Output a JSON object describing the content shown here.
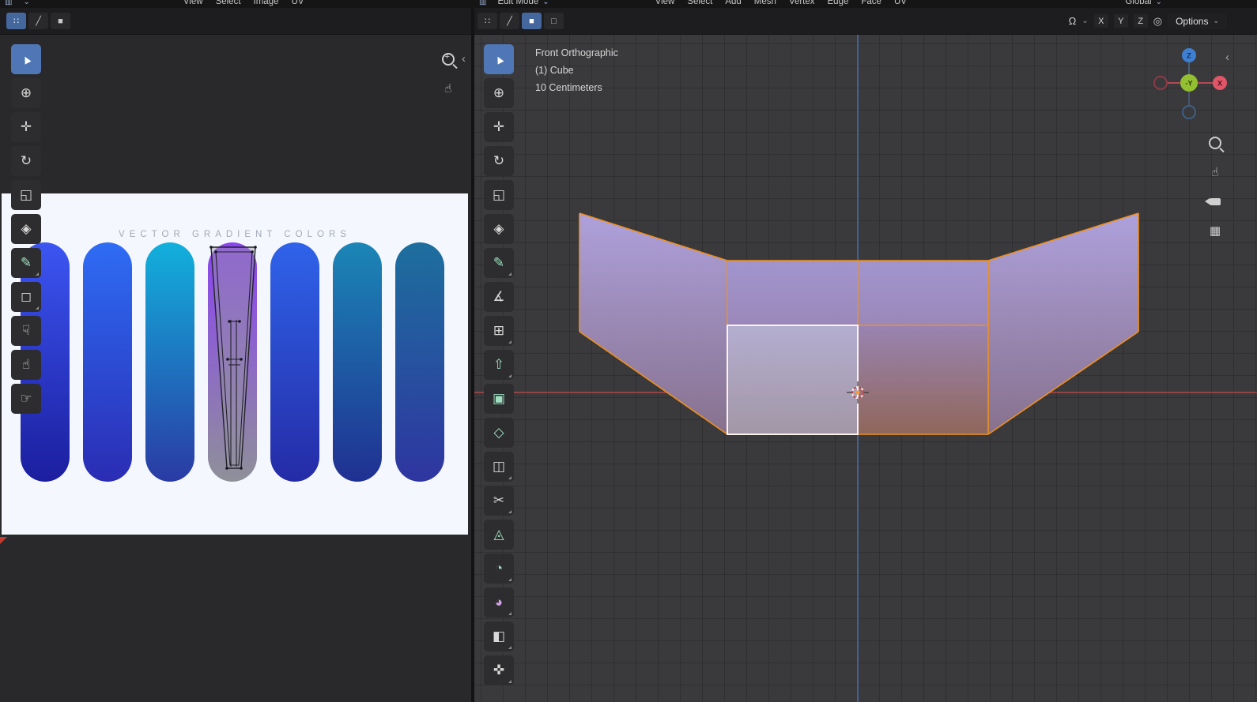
{
  "colors": {
    "accent": "#4f76b5",
    "edge_orange": "#ef8f1e",
    "active_face_outline": "#ffffff",
    "axis_x_line": "#a54848",
    "axis_z_line": "#4c6fae",
    "tool_green": "#9fe0c0",
    "tool_purple": "#cf9fe0",
    "image_bg": "#f4f7fd",
    "mesh": {
      "wing_top": "#b4a6e4",
      "wing_bottom": "#8b7492",
      "center_top": "#a79ad6",
      "center_mid": "#a08cc0",
      "lower_right_top": "#9e88b8",
      "lower_right_bottom": "#95695c",
      "active_top": "#bab4d8",
      "active_bottom": "#a89cac"
    }
  },
  "icons": {
    "editor_type": "▥",
    "chevron_down": "⌄",
    "collapse_left": "‹",
    "magnet": "Ω",
    "prop_edit": "◎",
    "grid": "▦",
    "hand": "☝"
  },
  "topbar": {
    "left_menus": [
      "View",
      "Select",
      "Image",
      "UV"
    ],
    "right_mode": "Edit Mode",
    "right_menus": [
      "View",
      "Select",
      "Add",
      "Mesh",
      "Vertex",
      "Edge",
      "Face",
      "UV"
    ],
    "orientation": "Global"
  },
  "left_editor": {
    "select_modes": [
      "∷",
      "╱",
      "■"
    ],
    "toolbar": [
      {
        "name": "select-box",
        "glyph": "▲",
        "selected": true
      },
      {
        "name": "cursor",
        "glyph": "⊕"
      },
      {
        "name": "move",
        "glyph": "✛"
      },
      {
        "name": "rotate",
        "glyph": "↻"
      },
      {
        "name": "scale",
        "glyph": "◱"
      },
      {
        "name": "transform",
        "glyph": "◈"
      },
      {
        "name": "annotate",
        "glyph": "✎",
        "color": "#9fe0c0"
      },
      {
        "name": "rip-region",
        "glyph": "◻"
      },
      {
        "name": "grab",
        "glyph": "☟"
      },
      {
        "name": "relax",
        "glyph": "☝"
      },
      {
        "name": "pinch",
        "glyph": "☞"
      }
    ],
    "image": {
      "title": "VECTOR GRADIENT COLORS",
      "pills": [
        {
          "top": "#3c55f2",
          "bottom": "#1b1e9e"
        },
        {
          "top": "#2e6cf4",
          "bottom": "#2b2cb4"
        },
        {
          "top": "#12b0dc",
          "bottom": "#2a3aa4"
        },
        {
          "top": "#8a43f2",
          "bottom": "#8f9099"
        },
        {
          "top": "#2f63ea",
          "bottom": "#252ba6"
        },
        {
          "top": "#1b86b6",
          "bottom": "#203092"
        },
        {
          "top": "#1d6f9e",
          "bottom": "#2f35a0"
        }
      ]
    }
  },
  "right_editor": {
    "header": {
      "select_modes": [
        "∷",
        "╱",
        "■",
        "□"
      ],
      "axis": [
        "X",
        "Y",
        "Z"
      ],
      "options_label": "Options"
    },
    "overlay": {
      "view_label": "Front Orthographic",
      "object_label": "(1) Cube",
      "scale_label": "10 Centimeters"
    },
    "toolbar": [
      {
        "name": "select-box",
        "glyph": "▲",
        "selected": true
      },
      {
        "name": "cursor",
        "glyph": "⊕"
      },
      {
        "name": "move",
        "glyph": "✛"
      },
      {
        "name": "rotate",
        "glyph": "↻"
      },
      {
        "name": "scale",
        "glyph": "◱"
      },
      {
        "name": "transform",
        "glyph": "◈"
      },
      {
        "name": "annotate",
        "glyph": "✎",
        "color": "#9fe0c0"
      },
      {
        "name": "measure",
        "glyph": "∡"
      },
      {
        "name": "add-cube",
        "glyph": "⊞"
      },
      {
        "name": "extrude-region",
        "glyph": "⇧",
        "color": "#9fe0c0"
      },
      {
        "name": "inset-faces",
        "glyph": "▣",
        "color": "#9fe0c0"
      },
      {
        "name": "bevel",
        "glyph": "◇",
        "color": "#9fe0c0"
      },
      {
        "name": "loop-cut",
        "glyph": "◫"
      },
      {
        "name": "knife",
        "glyph": "✂"
      },
      {
        "name": "poly-build",
        "glyph": "◬",
        "color": "#9fe0c0"
      },
      {
        "name": "spin",
        "glyph": "◔",
        "color": "#9fe0c0"
      },
      {
        "name": "smooth",
        "glyph": "◕",
        "color": "#cf9fe0"
      },
      {
        "name": "edge-slide",
        "glyph": "◧"
      },
      {
        "name": "shrink-fatten",
        "glyph": "✜"
      }
    ],
    "gizmo": {
      "z_label": "Z",
      "x_label": "X",
      "front_label": "-Y"
    }
  }
}
